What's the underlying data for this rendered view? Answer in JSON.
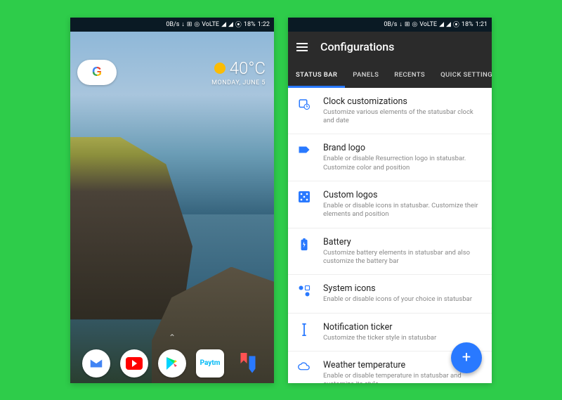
{
  "status": {
    "speed": "0B/s",
    "data_down": "↓",
    "volte": "VoLTE",
    "battery_text": "18%",
    "time_left": "1:22",
    "time_right": "1:21"
  },
  "home": {
    "temperature": "40°C",
    "date": "MONDAY, JUNE 5",
    "google_g": "G",
    "paytm_label": "Paytm",
    "drawer_arrow": "⌃"
  },
  "settings": {
    "title": "Configurations",
    "tabs": [
      "STATUS BAR",
      "PANELS",
      "RECENTS",
      "QUICK SETTINGS"
    ],
    "items": [
      {
        "icon": "calendar-clock",
        "title": "Clock customizations",
        "desc": "Customize various elements of the statusbar clock and date"
      },
      {
        "icon": "label",
        "title": "Brand logo",
        "desc": "Enable or disable Resurrection logo in statusbar. Customize color and position"
      },
      {
        "icon": "dice",
        "title": "Custom logos",
        "desc": "Enable or disable icons in statusbar. Customize their elements and position"
      },
      {
        "icon": "battery",
        "title": "Battery",
        "desc": "Customize battery elements in statusbar and also customize the battery bar"
      },
      {
        "icon": "auto",
        "title": "System icons",
        "desc": "Enable or disable icons of your choice in statusbar"
      },
      {
        "icon": "cursor",
        "title": "Notification ticker",
        "desc": "Customize the ticker style in statusbar"
      },
      {
        "icon": "cloud",
        "title": "Weather temperature",
        "desc": "Enable or disable temperature in statusbar and customize its style"
      }
    ],
    "fab": "+"
  }
}
